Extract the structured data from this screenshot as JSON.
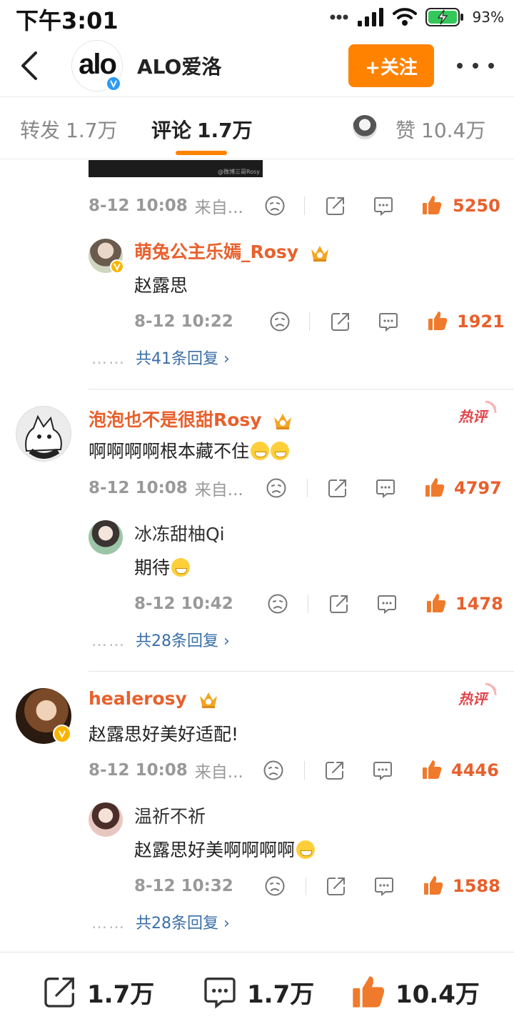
{
  "status_bar": {
    "time": "下午3:01",
    "battery_pct": "93%"
  },
  "header": {
    "account_name": "ALO爱洛",
    "logo_text": "alo",
    "follow_label": "+关注"
  },
  "tabs": {
    "repost": {
      "label": "转发",
      "count": "1.7万"
    },
    "comment": {
      "label": "评论",
      "count": "1.7万"
    },
    "like": {
      "label": "赞",
      "count": "10.4万"
    }
  },
  "feed": {
    "top_meta": {
      "time": "8-12 10:08",
      "source": "来自...",
      "likes": "5250"
    },
    "top_reply": {
      "user": "萌兔公主乐嫣_Rosy",
      "text": "赵露思",
      "time": "8-12 10:22",
      "likes": "1921"
    },
    "top_replies_link": "共41条回复",
    "comments": [
      {
        "user": "泡泡也不是很甜Rosy",
        "text": "啊啊啊啊根本藏不住",
        "time": "8-12 10:08",
        "source": "来自...",
        "likes": "4797",
        "reply": {
          "user": "冰冻甜柚Qi",
          "text": "期待",
          "time": "8-12 10:42",
          "likes": "1478"
        },
        "replies_link": "共28条回复"
      },
      {
        "user": "healerosy",
        "text": "赵露思好美好适配!",
        "time": "8-12 10:08",
        "source": "来自...",
        "likes": "4446",
        "reply": {
          "user": "温祈不祈",
          "text": "赵露思好美啊啊啊啊",
          "time": "8-12 10:32",
          "likes": "1588"
        },
        "replies_link": "共28条回复"
      }
    ]
  },
  "bottom_bar": {
    "repost_count": "1.7万",
    "comment_count": "1.7万",
    "like_count": "10.4万"
  },
  "colors": {
    "accent": "#ff8200",
    "username": "#e8602c",
    "link": "#3a6ea8"
  }
}
